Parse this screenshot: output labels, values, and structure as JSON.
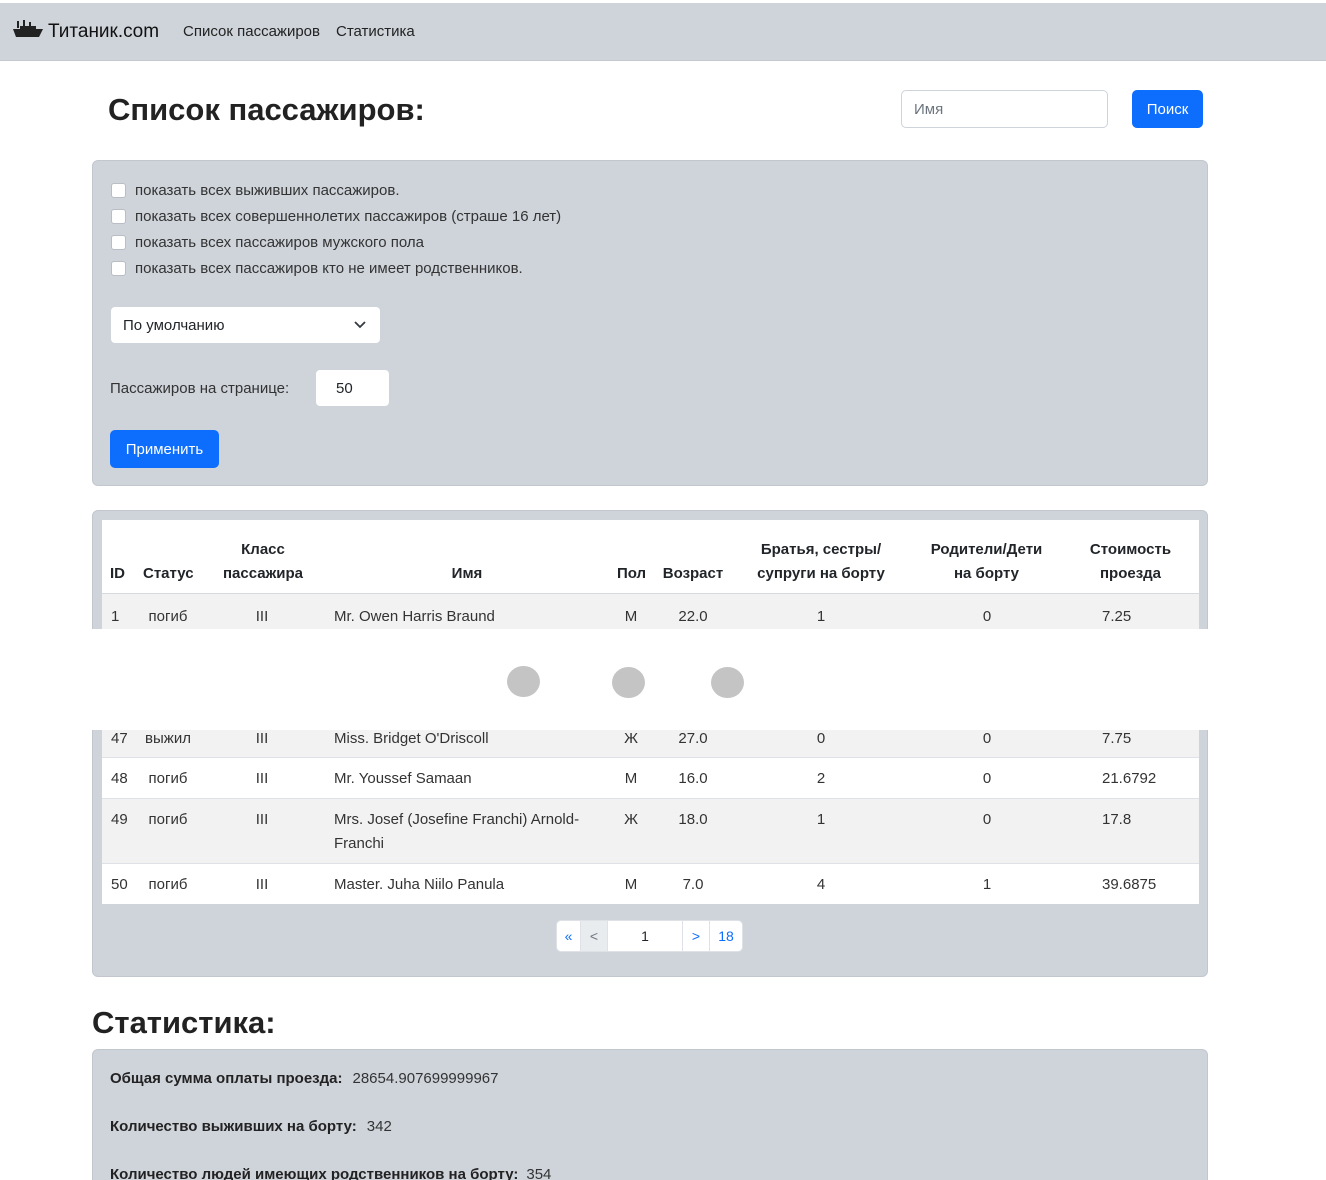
{
  "navbar": {
    "brand": "Титаник.com",
    "links": [
      "Список пассажиров",
      "Статистика"
    ]
  },
  "header": {
    "title": "Список пассажиров:",
    "search_placeholder": "Имя",
    "search_button": "Поиск"
  },
  "filters": {
    "checkboxes": [
      "показать всех выживших пассажиров.",
      "показать всех совершеннолетих пассажиров (страше 16 лет)",
      "показать всех пассажиров мужского пола",
      "показать всех пассажиров кто не имеет родственников."
    ],
    "sort_selected": "По умолчанию",
    "per_page_label": "Пассажиров на странице:",
    "per_page_value": "50",
    "apply_button": "Применить"
  },
  "table": {
    "headers": {
      "id": "ID",
      "status": "Статус",
      "class_line1": "Класс",
      "class_line2": "пассажира",
      "name": "Имя",
      "sex": "Пол",
      "age": "Возраст",
      "sib_line1": "Братья, сестры/",
      "sib_line2": "супруги на борту",
      "par_line1": "Родители/Дети",
      "par_line2": "на борту",
      "fare_line1": "Стоимость",
      "fare_line2": "проезда"
    },
    "rows": [
      {
        "id": "1",
        "status": "погиб",
        "pclass": "III",
        "name": "Mr. Owen Harris Braund",
        "name2": "",
        "sex": "М",
        "age": "22.0",
        "sib": "1",
        "par": "0",
        "fare": "7.25"
      },
      {
        "id": "47",
        "status": "выжил",
        "pclass": "III",
        "name": "Miss. Bridget O'Driscoll",
        "name2": "",
        "sex": "Ж",
        "age": "27.0",
        "sib": "0",
        "par": "0",
        "fare": "7.75"
      },
      {
        "id": "48",
        "status": "погиб",
        "pclass": "III",
        "name": "Mr. Youssef Samaan",
        "name2": "",
        "sex": "М",
        "age": "16.0",
        "sib": "2",
        "par": "0",
        "fare": "21.6792"
      },
      {
        "id": "49",
        "status": "погиб",
        "pclass": "III",
        "name": "Mrs. Josef (Josefine Franchi) Arnold-",
        "name2": "Franchi",
        "sex": "Ж",
        "age": "18.0",
        "sib": "1",
        "par": "0",
        "fare": "17.8"
      },
      {
        "id": "50",
        "status": "погиб",
        "pclass": "III",
        "name": "Master. Juha Niilo Panula",
        "name2": "",
        "sex": "М",
        "age": "7.0",
        "sib": "4",
        "par": "1",
        "fare": "39.6875"
      }
    ]
  },
  "pagination": {
    "first": "«",
    "prev": "<",
    "current": "1",
    "next": ">",
    "last": "18"
  },
  "stats": {
    "title": "Статистика:",
    "items": [
      {
        "label": "Общая сумма оплаты проезда:",
        "value": "28654.907699999967"
      },
      {
        "label": "Количество выживших на борту:",
        "value": "342"
      },
      {
        "label": "Количество людей имеющих родственников на борту:",
        "value": "354"
      }
    ]
  }
}
